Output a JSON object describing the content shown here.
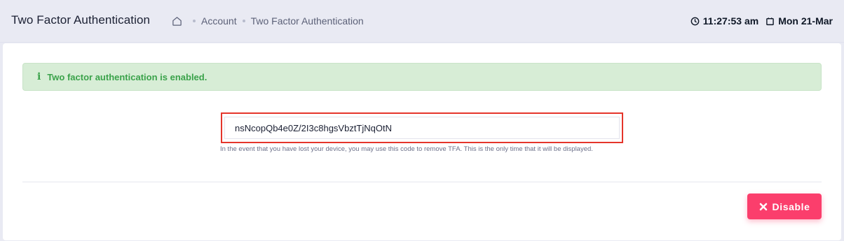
{
  "header": {
    "title": "Two Factor Authentication",
    "breadcrumb": {
      "home_icon": "home-icon",
      "items": [
        "Account",
        "Two Factor Authentication"
      ]
    },
    "clock": {
      "icon": "clock-icon",
      "time": "11:27:53 am"
    },
    "date": {
      "icon": "calendar-icon",
      "value": "Mon 21-Mar"
    }
  },
  "alert": {
    "icon": "info-icon",
    "glyph": "i",
    "message": "Two factor authentication is enabled.",
    "color": "#3aa24a",
    "background": "#d7edd6"
  },
  "recovery": {
    "code": "nsNcopQb4e0Z/2I3c8hgsVbztTjNqOtN",
    "help_text": "In the event that you have lost your device, you may use this code to remove TFA. This is the only time that it will be displayed.",
    "highlight_color": "#e5352b"
  },
  "actions": {
    "disable_label": "Disable",
    "disable_icon": "x-icon",
    "disable_color": "#fb3e6c"
  }
}
